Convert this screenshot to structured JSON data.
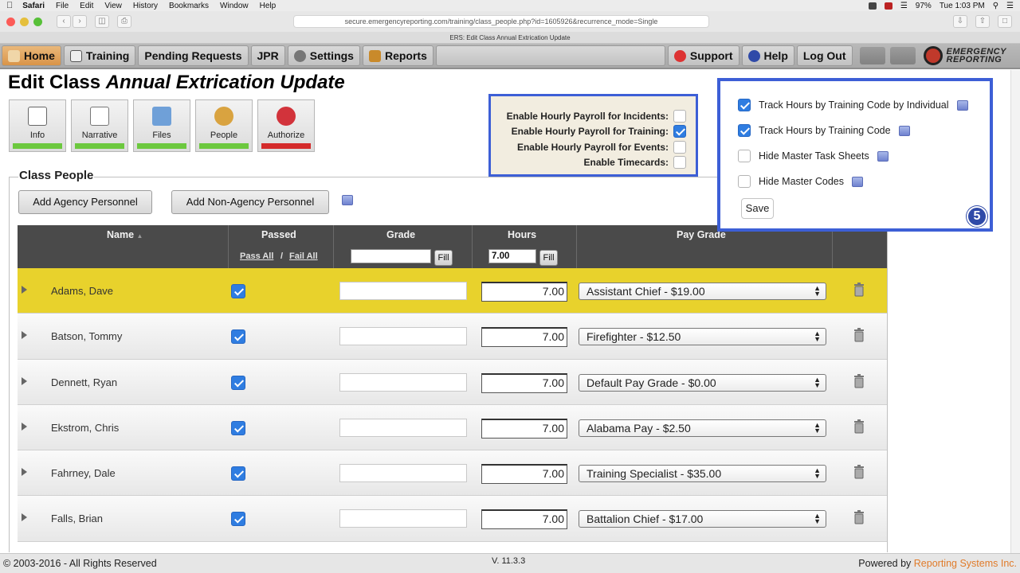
{
  "menubar": {
    "items": [
      "Safari",
      "File",
      "Edit",
      "View",
      "History",
      "Bookmarks",
      "Window",
      "Help"
    ],
    "battery": "97%",
    "clock": "Tue 1:03 PM"
  },
  "safari": {
    "url": "secure.emergencyreporting.com/training/class_people.php?id=1605926&recurrence_mode=Single",
    "tab_title": "ERS: Edit Class Annual Extrication Update"
  },
  "nav": {
    "home": "Home",
    "training": "Training",
    "pending": "Pending Requests",
    "jpr": "JPR",
    "settings": "Settings",
    "reports": "Reports",
    "support": "Support",
    "help": "Help",
    "logout": "Log Out",
    "logo_line1": "EMERGENCY",
    "logo_line2": "REPORTING"
  },
  "page": {
    "title_prefix": "Edit Class",
    "title_name": "Annual Extrication Update"
  },
  "sections": [
    "Info",
    "Narrative",
    "Files",
    "People",
    "Authorize"
  ],
  "payroll": {
    "incidents_label": "Enable Hourly Payroll for Incidents:",
    "incidents_checked": false,
    "training_label": "Enable Hourly Payroll for Training:",
    "training_checked": true,
    "events_label": "Enable Hourly Payroll for Events:",
    "events_checked": false,
    "timecards_label": "Enable Timecards:",
    "timecards_checked": false
  },
  "class_people": {
    "legend": "Class People",
    "add_agency": "Add Agency Personnel",
    "add_non_agency": "Add Non-Agency Personnel"
  },
  "table": {
    "headers": {
      "name": "Name",
      "passed": "Passed",
      "grade": "Grade",
      "hours": "Hours",
      "pay_grade": "Pay Grade"
    },
    "pass_all": "Pass All",
    "slash": "/",
    "fail_all": "Fail All",
    "grade_fill_value": "",
    "hours_fill_value": "7.00",
    "fill_label": "Fill",
    "rows": [
      {
        "name": "Adams, Dave",
        "passed": true,
        "hours": "7.00",
        "pay_grade": "Assistant Chief - $19.00",
        "selected": true
      },
      {
        "name": "Batson, Tommy",
        "passed": true,
        "hours": "7.00",
        "pay_grade": "Firefighter - $12.50",
        "selected": false
      },
      {
        "name": "Dennett, Ryan",
        "passed": true,
        "hours": "7.00",
        "pay_grade": "Default Pay Grade - $0.00",
        "selected": false
      },
      {
        "name": "Ekstrom, Chris",
        "passed": true,
        "hours": "7.00",
        "pay_grade": "Alabama Pay - $2.50",
        "selected": false
      },
      {
        "name": "Fahrney, Dale",
        "passed": true,
        "hours": "7.00",
        "pay_grade": "Training Specialist - $35.00",
        "selected": false
      },
      {
        "name": "Falls, Brian",
        "passed": true,
        "hours": "7.00",
        "pay_grade": "Battalion Chief - $17.00",
        "selected": false
      }
    ]
  },
  "options": {
    "track_individual": "Track Hours by Training Code by Individual",
    "track_individual_checked": true,
    "track_code": "Track Hours by Training Code",
    "track_code_checked": true,
    "hide_task_sheets": "Hide Master Task Sheets",
    "hide_task_sheets_checked": false,
    "hide_codes": "Hide Master Codes",
    "hide_codes_checked": false,
    "save": "Save",
    "step": "5"
  },
  "footer": {
    "copyright": "© 2003-2016 - All Rights Reserved",
    "version": "V. 11.3.3",
    "powered_by": "Powered by",
    "company": "Reporting Systems Inc."
  },
  "colors": {
    "highlight_border": "#3d5fd6",
    "selected_row": "#e8d22c",
    "checkbox_on": "#2f7de1",
    "status_green": "#6cc83e",
    "status_red": "#d42b2b"
  }
}
